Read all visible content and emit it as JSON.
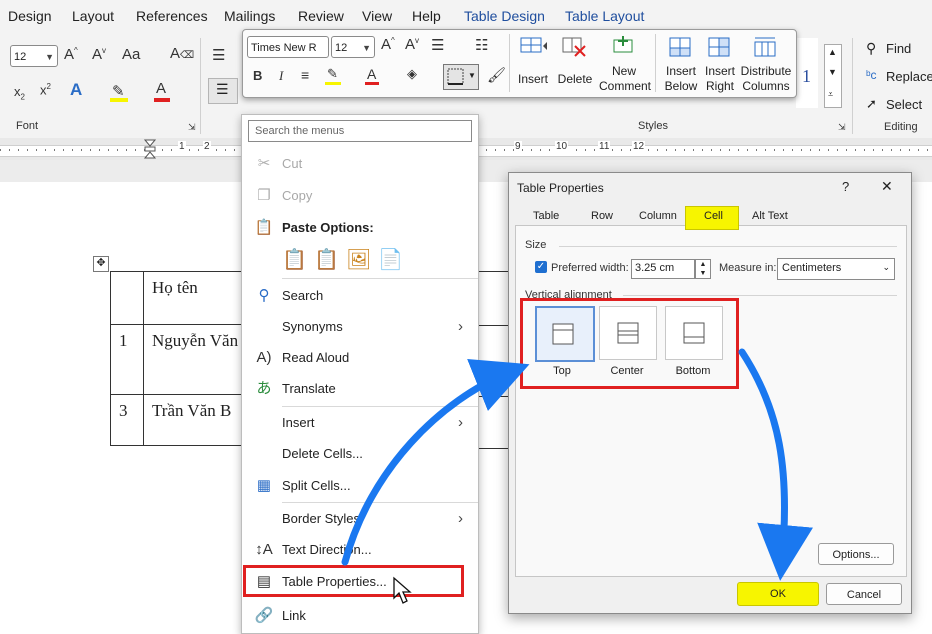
{
  "menubar": {
    "tabs": [
      "Design",
      "Layout",
      "References",
      "Mailings",
      "Review",
      "View",
      "Help",
      "Table Design",
      "Table Layout"
    ]
  },
  "ribbon": {
    "font_size": "12",
    "group_font": "Font",
    "group_styles": "Styles",
    "group_editing": "Editing",
    "find": "Find",
    "replace": "Replace",
    "select": "Select",
    "styles_sample": "1"
  },
  "ruler": {
    "numbers": [
      "1",
      "2",
      "9",
      "10",
      "11",
      "12"
    ]
  },
  "mini_toolbar": {
    "font_name": "Times New R",
    "font_size": "12",
    "insert": "Insert",
    "delete": "Delete",
    "new_comment": [
      "New",
      "Comment"
    ],
    "insert_below": [
      "Insert",
      "Below"
    ],
    "insert_right": [
      "Insert",
      "Right"
    ],
    "distribute_columns": [
      "Distribute",
      "Columns"
    ]
  },
  "table": {
    "rows": [
      [
        "",
        "Họ tên"
      ],
      [
        "1",
        "Nguyễn Văn"
      ],
      [
        "3",
        "Trần Văn B"
      ]
    ]
  },
  "context_menu": {
    "search_placeholder": "Search the menus",
    "items": {
      "cut": "Cut",
      "copy": "Copy",
      "paste_options": "Paste Options:",
      "search": "Search",
      "synonyms": "Synonyms",
      "read_aloud": "Read Aloud",
      "translate": "Translate",
      "insert": "Insert",
      "delete_cells": "Delete Cells...",
      "split_cells": "Split Cells...",
      "border_styles": "Border Styles",
      "text_direction": "Text Direction...",
      "table_properties": "Table Properties...",
      "link": "Link"
    }
  },
  "dialog": {
    "title": "Table Properties",
    "help": "?",
    "close": "✕",
    "tabs": [
      "Table",
      "Row",
      "Column",
      "Cell",
      "Alt Text"
    ],
    "active_tab": "Cell",
    "size_label": "Size",
    "preferred_width_label": "Preferred width:",
    "preferred_width_value": "3.25 cm",
    "measure_in_label": "Measure in:",
    "measure_in_value": "Centimeters",
    "vertical_alignment_label": "Vertical alignment",
    "alignments": [
      "Top",
      "Center",
      "Bottom"
    ],
    "selected_alignment": "Top",
    "options_button": "Options...",
    "ok_button": "OK",
    "cancel_button": "Cancel"
  },
  "colors": {
    "highlight": "#f7f500",
    "annotation_red": "#e02020",
    "arrow_blue": "#1a78f0",
    "accent_tab": "#1f4e9e"
  }
}
